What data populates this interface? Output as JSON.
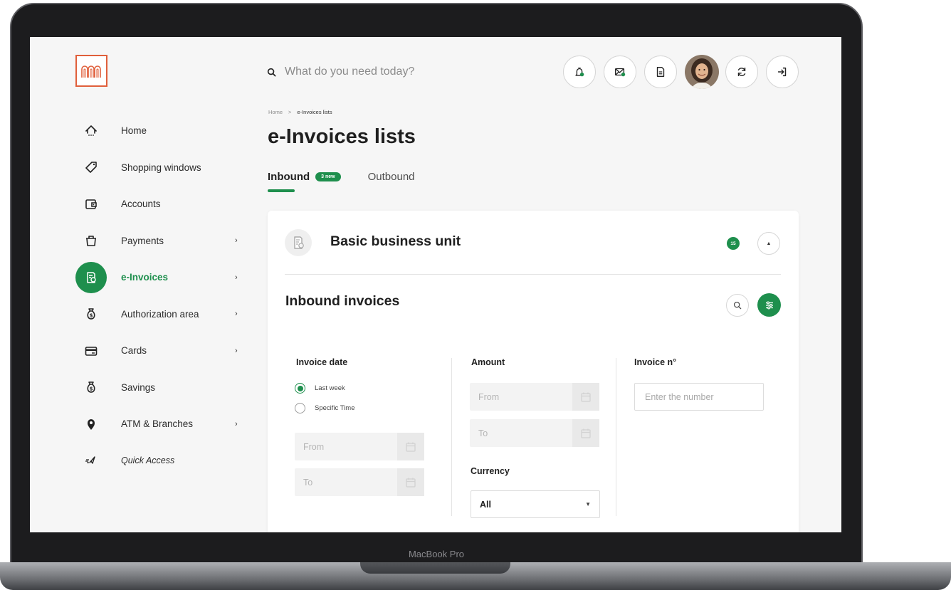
{
  "device": {
    "label": "MacBook Pro"
  },
  "search": {
    "placeholder": "What do you need today?"
  },
  "sidebar": {
    "items": [
      {
        "label": "Home",
        "icon": "home-icon",
        "chevron": false
      },
      {
        "label": "Shopping windows",
        "icon": "tag-icon",
        "chevron": false
      },
      {
        "label": "Accounts",
        "icon": "wallet-icon",
        "chevron": false
      },
      {
        "label": "Payments",
        "icon": "basket-icon",
        "chevron": true
      },
      {
        "label": "e-Invoices",
        "icon": "invoice-icon",
        "chevron": true,
        "active": true
      },
      {
        "label": "Authorization area",
        "icon": "money-bag-icon",
        "chevron": true
      },
      {
        "label": "Cards",
        "icon": "card-icon",
        "chevron": true
      },
      {
        "label": "Savings",
        "icon": "money-bag-icon",
        "chevron": false
      },
      {
        "label": "ATM & Branches",
        "icon": "location-pin-icon",
        "chevron": true
      },
      {
        "label": "Quick Access",
        "icon": "rocket-icon",
        "chevron": false
      }
    ],
    "chevron_glyph": "›"
  },
  "topbar": {
    "buttons": [
      "bell-icon",
      "mail-icon",
      "document-icon",
      "refresh-icon",
      "logout-icon"
    ]
  },
  "breadcrumb": {
    "home": "Home",
    "separator": ">",
    "current": "e-Invoices lists"
  },
  "page": {
    "title": "e-Invoices lists"
  },
  "tabs": {
    "inbound": "Inbound",
    "inbound_badge": "3 new",
    "outbound": "Outbound"
  },
  "card": {
    "business_unit": "Basic business unit",
    "count": "15",
    "collapse_glyph": "▲",
    "section_title": "Inbound invoices"
  },
  "filters": {
    "invoice_date": {
      "label": "Invoice date",
      "options": [
        "Last week",
        "Specific Time"
      ],
      "selected": "Last week",
      "from_placeholder": "From",
      "to_placeholder": "To"
    },
    "amount": {
      "label": "Amount",
      "from_placeholder": "From",
      "to_placeholder": "To"
    },
    "currency": {
      "label": "Currency",
      "value": "All",
      "caret": "▼"
    },
    "invoice_number": {
      "label": "Invoice n°",
      "placeholder": "Enter the number"
    }
  },
  "colors": {
    "accent": "#1e8f4d",
    "logo": "#e05f3b",
    "background": "#f6f6f6"
  }
}
